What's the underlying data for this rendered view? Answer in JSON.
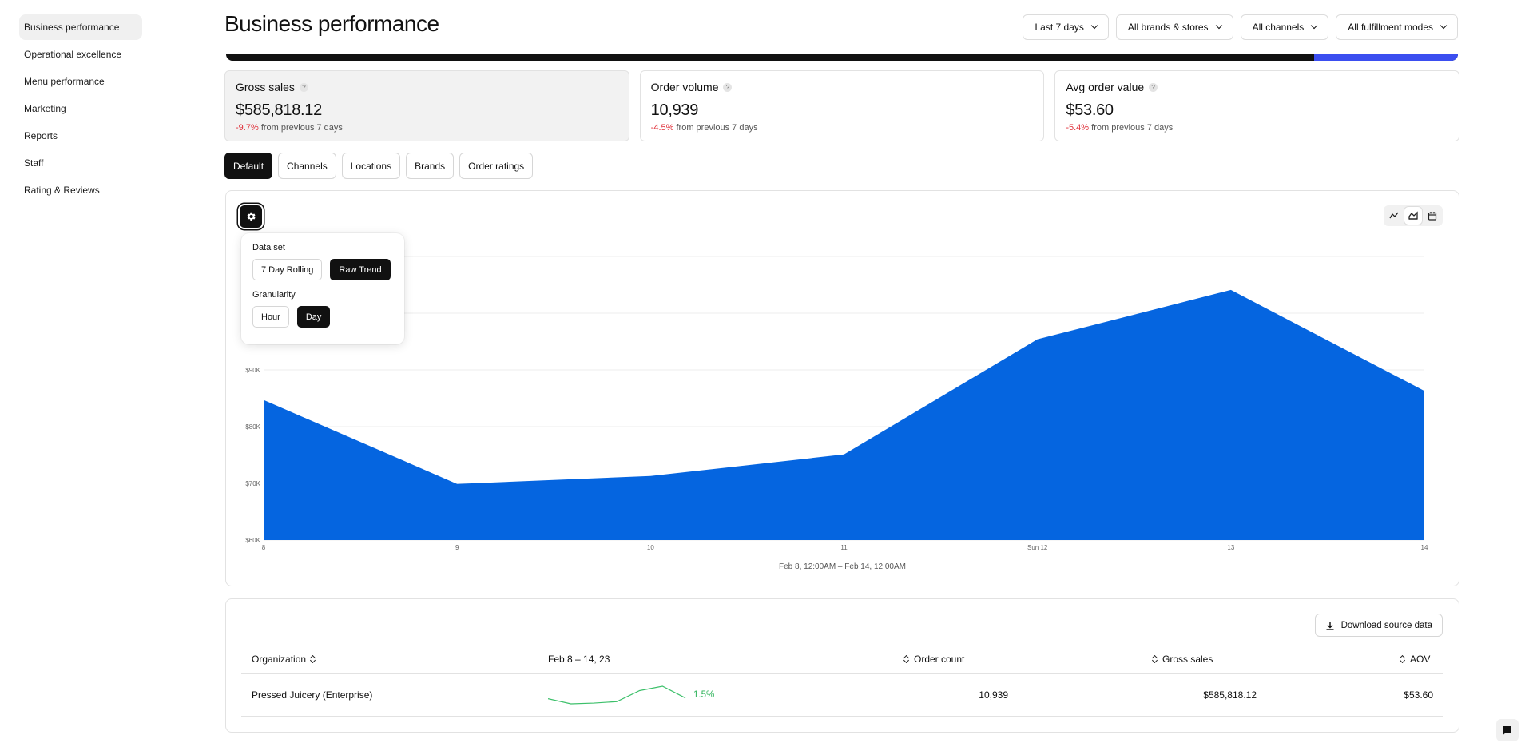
{
  "sidebar": {
    "items": [
      {
        "label": "Business performance"
      },
      {
        "label": "Operational excellence"
      },
      {
        "label": "Menu performance"
      },
      {
        "label": "Marketing"
      },
      {
        "label": "Reports"
      },
      {
        "label": "Staff"
      },
      {
        "label": "Rating & Reviews"
      }
    ]
  },
  "header": {
    "title": "Business performance",
    "filters": [
      "Last 7 days",
      "All brands & stores",
      "All channels",
      "All fulfillment modes"
    ]
  },
  "kpis": [
    {
      "label": "Gross sales",
      "value": "$585,818.12",
      "delta": "-9.7%",
      "delta_text": "from previous 7 days"
    },
    {
      "label": "Order volume",
      "value": "10,939",
      "delta": "-4.5%",
      "delta_text": "from previous 7 days"
    },
    {
      "label": "Avg order value",
      "value": "$53.60",
      "delta": "-5.4%",
      "delta_text": "from previous 7 days"
    }
  ],
  "tabs": [
    "Default",
    "Channels",
    "Locations",
    "Brands",
    "Order ratings"
  ],
  "popover": {
    "dataset_label": "Data set",
    "dataset_options": [
      "7 Day Rolling",
      "Raw Trend"
    ],
    "granularity_label": "Granularity",
    "granularity_options": [
      "Hour",
      "Day"
    ]
  },
  "chart_data": {
    "type": "area",
    "categories": [
      "8",
      "9",
      "10",
      "11",
      "Sun 12",
      "13",
      "14"
    ],
    "values": [
      84700,
      69900,
      71300,
      75100,
      95400,
      104100,
      86300
    ],
    "ylim": [
      60000,
      110000
    ],
    "yticks": [
      60000,
      70000,
      80000,
      90000,
      100000,
      110000
    ],
    "ytick_labels": [
      "$60K",
      "$70K",
      "$80K",
      "$90K",
      "",
      ""
    ],
    "grid": true,
    "color": "#0565e0",
    "caption": "Feb 8, 12:00AM – Feb 14, 12:00AM"
  },
  "table": {
    "download_label": "Download source data",
    "headers": {
      "organization": "Organization",
      "trend": "Feb 8 – 14, 23",
      "order_count": "Order count",
      "gross_sales": "Gross sales",
      "aov": "AOV"
    },
    "rows": [
      {
        "organization": "Pressed Juicery (Enterprise)",
        "trend_values": [
          7.5,
          6.8,
          6.9,
          7.1,
          8.6,
          9.2,
          7.6
        ],
        "trend_pct": "1.5%",
        "order_count": "10,939",
        "gross_sales": "$585,818.12",
        "aov": "$53.60"
      }
    ]
  }
}
